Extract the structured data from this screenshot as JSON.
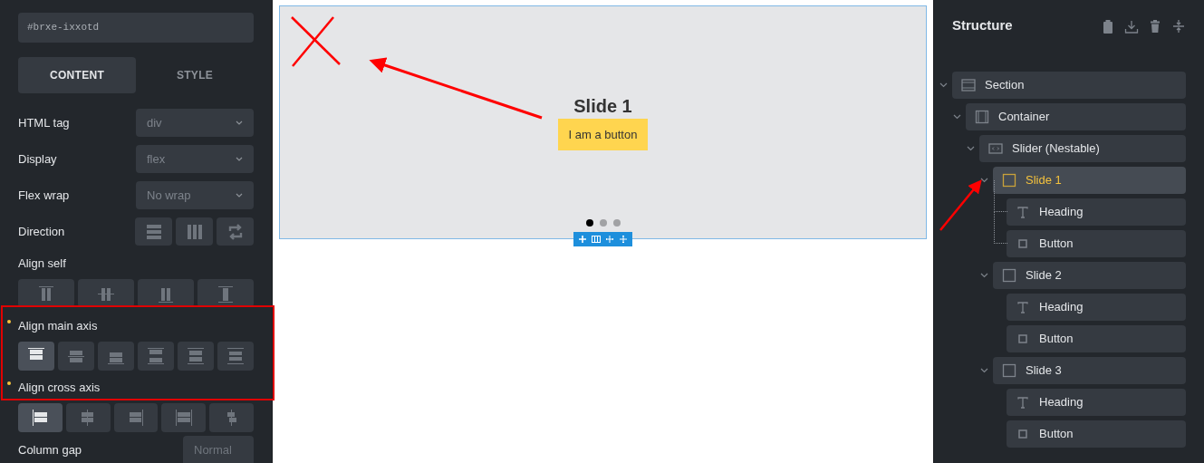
{
  "element_id": "#brxe-ixxotd",
  "tabs": [
    {
      "label": "CONTENT",
      "selected": true
    },
    {
      "label": "STYLE",
      "selected": false
    }
  ],
  "controls": [
    {
      "kind": "select",
      "label": "HTML tag",
      "value": "div",
      "modified": false
    },
    {
      "kind": "select",
      "label": "Display",
      "value": "flex",
      "modified": false
    },
    {
      "kind": "select",
      "label": "Flex wrap",
      "value": "No wrap",
      "modified": false
    },
    {
      "kind": "direction",
      "label": "Direction",
      "modified": false,
      "options": [
        {
          "selected": false
        },
        {
          "selected": false
        },
        {
          "selected": false
        }
      ]
    },
    {
      "kind": "align_self",
      "label": "Align self",
      "modified": false,
      "options": [
        {
          "selected": false
        },
        {
          "selected": false
        },
        {
          "selected": false
        },
        {
          "selected": false
        }
      ]
    },
    {
      "kind": "align_main",
      "label": "Align main axis",
      "modified": true,
      "options": [
        {
          "selected": true
        },
        {
          "selected": false
        },
        {
          "selected": false
        },
        {
          "selected": false
        },
        {
          "selected": false
        },
        {
          "selected": false
        }
      ]
    },
    {
      "kind": "align_cross",
      "label": "Align cross axis",
      "modified": true,
      "options": [
        {
          "selected": true
        },
        {
          "selected": false
        },
        {
          "selected": false
        },
        {
          "selected": false
        },
        {
          "selected": false
        }
      ]
    },
    {
      "kind": "number",
      "label": "Column gap",
      "placeholder": "Normal",
      "modified": false
    }
  ],
  "canvas": {
    "slide_heading": "Slide 1",
    "slide_button": "I am a button",
    "pagination": [
      {
        "selected": true
      },
      {
        "selected": false
      },
      {
        "selected": false
      }
    ]
  },
  "structure": {
    "title": "Structure",
    "tree": [
      {
        "label": "Section",
        "kind": "section",
        "expanded": true,
        "selected": false,
        "children": [
          {
            "label": "Container",
            "kind": "container",
            "expanded": true,
            "selected": false,
            "children": [
              {
                "label": "Slider (Nestable)",
                "kind": "slider",
                "expanded": true,
                "selected": false,
                "children": [
                  {
                    "label": "Slide 1",
                    "kind": "slide",
                    "expanded": true,
                    "selected": true,
                    "children": [
                      {
                        "label": "Heading",
                        "kind": "heading",
                        "selected": false
                      },
                      {
                        "label": "Button",
                        "kind": "button",
                        "selected": false
                      }
                    ]
                  },
                  {
                    "label": "Slide 2",
                    "kind": "slide",
                    "expanded": true,
                    "selected": false,
                    "children": [
                      {
                        "label": "Heading",
                        "kind": "heading",
                        "selected": false
                      },
                      {
                        "label": "Button",
                        "kind": "button",
                        "selected": false
                      }
                    ]
                  },
                  {
                    "label": "Slide 3",
                    "kind": "slide",
                    "expanded": true,
                    "selected": false,
                    "children": [
                      {
                        "label": "Heading",
                        "kind": "heading",
                        "selected": false
                      },
                      {
                        "label": "Button",
                        "kind": "button",
                        "selected": false
                      }
                    ]
                  }
                ]
              }
            ]
          }
        ]
      }
    ]
  }
}
